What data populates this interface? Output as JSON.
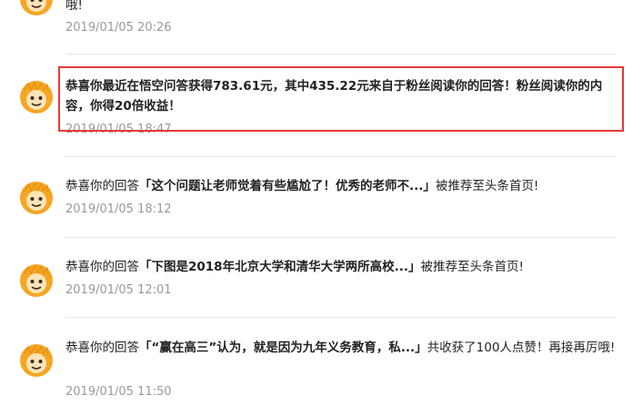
{
  "items": [
    {
      "text_tail": "哦!",
      "time": "2019/01/05 20:26"
    },
    {
      "bold_text": "恭喜你最近在悟空问答获得783.61元，其中435.22元来自于粉丝阅读你的回答！粉丝阅读你的内容，你得20倍收益！",
      "time": "2019/01/05 18:47",
      "highlighted": true,
      "highlight_color": "#e53935"
    },
    {
      "prefix": "恭喜你的回答",
      "bold": "「这个问题让老师觉着有些尴尬了！优秀的老师不...」",
      "suffix": "被推荐至头条首页!",
      "time": "2019/01/05 18:12"
    },
    {
      "prefix": "恭喜你的回答",
      "bold": "「下图是2018年北京大学和清华大学两所高校...」",
      "suffix": "被推荐至头条首页!",
      "time": "2019/01/05 12:01"
    },
    {
      "prefix": "恭喜你的回答",
      "bold": "「“赢在高三”认为，就是因为九年义务教育，私...」",
      "suffix": "共收获了100人点赞！再接再厉哦!",
      "time": "2019/01/05 11:50"
    }
  ],
  "colors": {
    "avatar_body": "#f5a623",
    "avatar_face": "#fce4b8",
    "divider": "#e8e8e8",
    "time_text": "#999999"
  },
  "icons": {
    "avatar": "monkey-avatar-icon"
  }
}
